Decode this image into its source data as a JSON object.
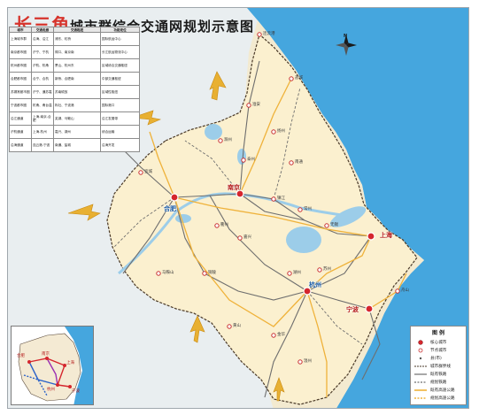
{
  "map": {
    "title_main": "长三角",
    "title_rest": "城市群综合交通网规划示意图",
    "core_cities": [
      {
        "name": "上海",
        "style": "red"
      },
      {
        "name": "南京",
        "style": "red"
      },
      {
        "name": "合肥",
        "style": "blue"
      },
      {
        "name": "杭州",
        "style": "blue"
      },
      {
        "name": "宁波",
        "style": "red"
      }
    ],
    "other_places": [
      "连云港",
      "盐城",
      "淮安",
      "扬州",
      "泰州",
      "南通",
      "镇江",
      "常州",
      "无锡",
      "苏州",
      "湖州",
      "嘉兴",
      "绍兴",
      "舟山",
      "台州",
      "金华",
      "衢州",
      "芜湖",
      "马鞍山",
      "铜陵",
      "安庆",
      "池州",
      "宣城",
      "滁州",
      "蚌埠",
      "淮南",
      "六安",
      "黄山",
      "温州"
    ],
    "colors": {
      "sea": "#45a6de",
      "land_region": "#fbf0cf",
      "outside_region": "#e9eef0",
      "lake": "#9ccde9",
      "city_core": "#d5262d",
      "railway": "#6e6e6e",
      "highway": "#efb23a",
      "region_border": "#4b3a28"
    },
    "table": {
      "headers": [
        "城市",
        "交通走廊",
        "交通枢纽",
        "功能定位"
      ],
      "rows": [
        [
          "上海城市群",
          "沿海、沿江",
          "浦东、虹桥",
          "国际航运中心"
        ],
        [
          "南京都市圈",
          "沪宁、宁杭",
          "禄口、南京南",
          "长江航运物流中心"
        ],
        [
          "杭州都市圈",
          "沪杭、杭甬",
          "萧山、杭州东",
          "区域综合交通枢纽"
        ],
        [
          "合肥都市圈",
          "合宁、合杭",
          "新桥、合肥南",
          "中部交通枢纽"
        ],
        [
          "苏锡常都市圈",
          "沪宁、通苏嘉",
          "苏南硕放",
          "区域性枢纽"
        ],
        [
          "宁波都市圈",
          "杭甬、甬台温",
          "栎社、宁波港",
          "国际港口"
        ],
        [
          "沿江通道",
          "上海-南京-合肥",
          "芜湖、马鞍山",
          "沿江发展带"
        ],
        [
          "沪杭通道",
          "上海-杭州",
          "嘉兴、湖州",
          "综合运输"
        ],
        [
          "沿海通道",
          "连云港-宁波",
          "南通、盐城",
          "沿海开发"
        ]
      ]
    },
    "legend": {
      "title": "图  例",
      "items": [
        {
          "label": "核心城市",
          "symbol": "core-city"
        },
        {
          "label": "节点城市",
          "symbol": "node-city"
        },
        {
          "label": "县(市)",
          "symbol": "county"
        },
        {
          "label": "城市群界线",
          "symbol": "region-border"
        },
        {
          "label": "既有铁路",
          "symbol": "existing-rail"
        },
        {
          "label": "规划铁路",
          "symbol": "planned-rail"
        },
        {
          "label": "既有高速公路",
          "symbol": "existing-highway"
        },
        {
          "label": "规划高速公路",
          "symbol": "planned-highway"
        }
      ]
    },
    "inset_labels": [
      "合肥",
      "南京",
      "杭州",
      "上海",
      "宁波"
    ],
    "compass_label": "N"
  }
}
